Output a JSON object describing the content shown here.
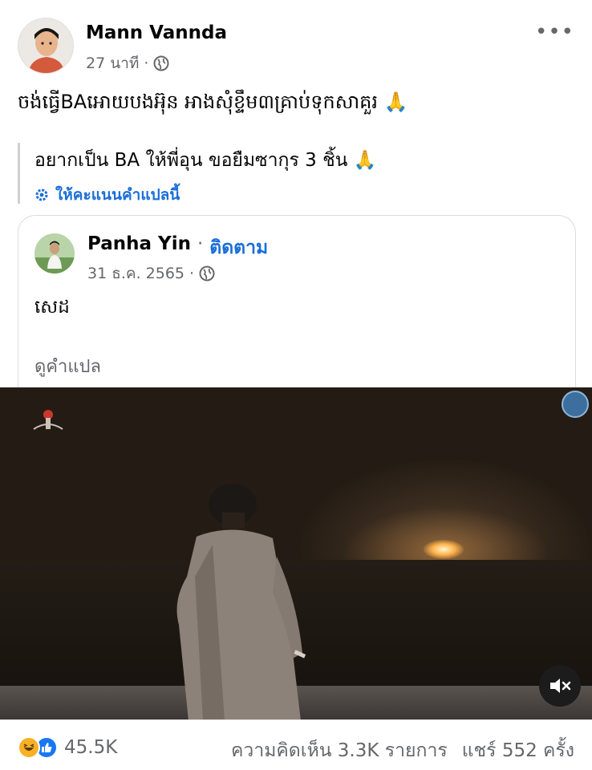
{
  "post": {
    "author_name": "Mann Vannda",
    "time": "27 นาที",
    "separator": "·",
    "privacy_icon": "globe-icon",
    "more_icon": "more-dots-icon",
    "more_label": "•••",
    "text": "ចង់ធ្វើBAអោយបងអ៊ុន អាងសុំខ្ទឹម៣គ្រាប់ទុកសាគួរ 🙏",
    "translation": "อยากเป็น BA ให้พี่อุน ขอยืมซากุร 3 ชิ้น 🙏",
    "rate_translation_label": "ให้คะแนนคำแปลนี้",
    "rate_icon": "gear-icon"
  },
  "shared_post": {
    "author_name": "Panha Yin",
    "separator": "·",
    "follow_label": "ติดตาม",
    "time": "31 ธ.ค. 2565",
    "privacy_icon": "globe-icon",
    "text": "សេដ",
    "see_translation_label": "ดูคำแปล"
  },
  "video": {
    "mute_icon": "volume-muted-icon",
    "channel_logo_icon": "channel-logo-icon",
    "watermark_icon": "watermark-icon"
  },
  "footer": {
    "reaction_icons": [
      "haha-reaction-icon",
      "like-reaction-icon"
    ],
    "reaction_count": "45.5K",
    "comments": "ความคิดเห็น 3.3K รายการ",
    "shares": "แชร์ 552 ครั้ง"
  },
  "colors": {
    "link_blue": "#1a6ed8",
    "secondary_text": "#65676b",
    "like_blue": "#1877f2",
    "haha_yellow": "#f7b125"
  }
}
